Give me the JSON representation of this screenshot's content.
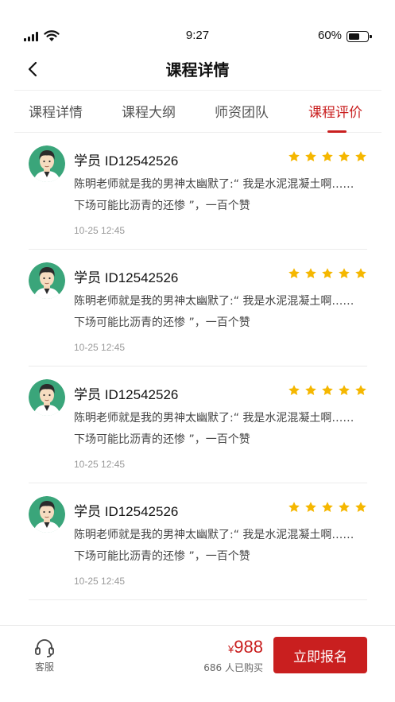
{
  "status_bar": {
    "time": "9:27",
    "battery_text": "60%",
    "battery_level": 0.6
  },
  "nav": {
    "title": "课程详情",
    "back_icon": "chevron-left-icon"
  },
  "tabs": [
    {
      "label": "课程详情",
      "active": false
    },
    {
      "label": "课程大纲",
      "active": false
    },
    {
      "label": "师资团队",
      "active": false
    },
    {
      "label": "课程评价",
      "active": true
    }
  ],
  "colors": {
    "accent": "#c91f1f",
    "star": "#f5b700",
    "avatar_bg": "#3aa57a"
  },
  "reviews": [
    {
      "name": "学员 ID12542526",
      "rating": 5,
      "text_line1": "陈明老师就是我的男神太幽默了:“ 我是水泥混凝土啊……",
      "text_line2": "下场可能比沥青的还惨 ”，一百个赞",
      "time": "10-25  12:45"
    },
    {
      "name": "学员 ID12542526",
      "rating": 5,
      "text_line1": "陈明老师就是我的男神太幽默了:“ 我是水泥混凝土啊……",
      "text_line2": "下场可能比沥青的还惨 ”，一百个赞",
      "time": "10-25  12:45"
    },
    {
      "name": "学员 ID12542526",
      "rating": 5,
      "text_line1": "陈明老师就是我的男神太幽默了:“ 我是水泥混凝土啊……",
      "text_line2": "下场可能比沥青的还惨 ”，一百个赞",
      "time": "10-25  12:45"
    },
    {
      "name": "学员 ID12542526",
      "rating": 5,
      "text_line1": "陈明老师就是我的男神太幽默了:“ 我是水泥混凝土啊……",
      "text_line2": "下场可能比沥青的还惨 ”，一百个赞",
      "time": "10-25  12:45"
    }
  ],
  "bottom_bar": {
    "service_label": "客服",
    "service_icon": "headset-icon",
    "currency": "¥",
    "price": "988",
    "buyers": "686 人已购买",
    "enroll_label": "立即报名"
  }
}
